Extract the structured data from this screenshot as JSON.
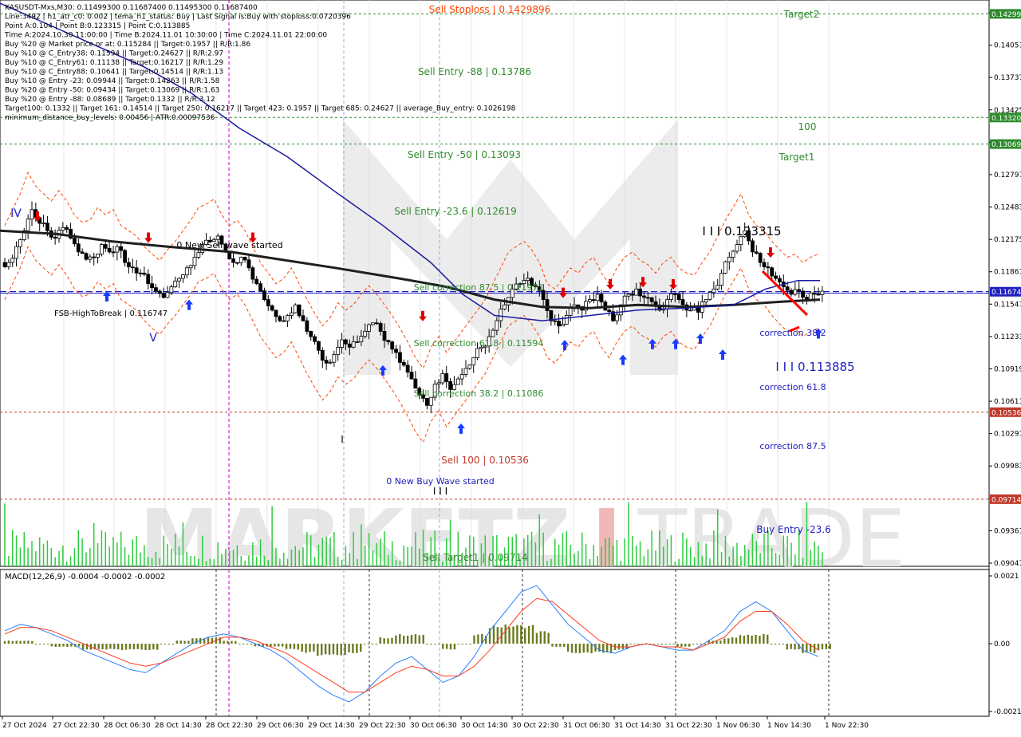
{
  "colors": {
    "background": "#ffffff",
    "grid": "#c8c8c8",
    "watermark": "#e6e6e6",
    "watermark_red": "#f2b7b7",
    "candle": "#000000",
    "volume": "#2ecc40",
    "ma_slow": "#1f1f1f",
    "ma_fast": "#1a1aa0",
    "envelope": "#ff4500",
    "level_green": "#2e8b2e",
    "level_red": "#c0392b",
    "level_blue": "#2020c0",
    "macd_hist": "#6b7a1f",
    "macd_main": "#2a7fff",
    "macd_signal": "#ff3b1f",
    "axis_text": "#000000"
  },
  "info_panel": [
    "KASUSDT-Mxs,M30: 0.11499300 0.11687400 0.11495300 0.11687400",
    "Line:3492 | h1_atr_c0: 0.002 | tema_h1_status: Buy | Last Signal is:Buy with stoploss:0.0720396",
    "Point A:0.104 | Point B:0.123315 | Point C:0.113885",
    "Time A:2024.10.30 11:00:00 | Time B:2024.11.01 10:30:00 | Time C:2024.11.01 22:00:00",
    "Buy %20 @ Market price or at: 0.115284 || Target:0.1957 || R/R:1.86",
    "Buy %10 @ C_Entry38: 0.11594 || Target:0.24627 || R/R:2.97",
    "Buy %10 @ C_Entry61: 0.11138 || Target:0.16217 || R/R:1.29",
    "Buy %10 @ C_Entry88: 0.10641 || Target:0.14514 || R/R:1.13",
    "Buy %10 @ Entry -23: 0.09944 || Target:0.14263 || R/R:1.58",
    "Buy %20 @ Entry -50: 0.09434 || Target:0.13069 || R/R:1.63",
    "Buy %20 @ Entry -88: 0.08689 || Target:0.1332 || R/R:3.12",
    "Target100: 0.1332 || Target 161: 0.14514 || Target 250: 0.16217 || Target 423: 0.1957 || Target 685: 0.24627 || average_Buy_entry: 0.1026198",
    "minimum_distance_buy_levels: 0.00456 | ATR:0.00097536"
  ],
  "chart_labels": {
    "sell_stoploss": "Sell Stoploss | 0.1429896",
    "target2": "Target2",
    "sell_entry_88": "Sell Entry -88 | 0.13786",
    "level_100": "100",
    "sell_entry_50": "Sell Entry -50 | 0.13093",
    "target1": "Target1",
    "sell_entry_23": "Sell Entry -23.6 | 0.12619",
    "peak_label": "I I I 0.123315",
    "new_sell_wave": "0 New Sell wave started",
    "sell_corr_875": "Sell correction 87.5 | 0.11971",
    "fsb": "FSB-HighToBreak | 0.116747",
    "sell_corr_618": "Sell correction 61.8 | 0.11594",
    "sell_corr_382": "Sell correction 38.2 | 0.11086",
    "correction_382": "correction 38.2",
    "c_label": "I I I 0.113885",
    "correction_618": "correction 61.8",
    "correction_875": "correction 87.5",
    "sell_100": "Sell 100 | 0.10536",
    "new_buy_wave": "0 New Buy Wave started",
    "buy_entry_23": "Buy Entry -23.6",
    "sell_target1": "Sell Target1 | 0.09714",
    "wave_iv": "IV",
    "wave_v": "V",
    "wave_i": "I",
    "wave_iii": "I I I"
  },
  "watermark": {
    "left": "MARKETZ",
    "bar": "I",
    "right": "TRADE"
  },
  "price_axis": {
    "ticks": [
      "0.14365",
      "0.14051",
      "0.13737",
      "0.13425",
      "0.13111",
      "0.12797",
      "0.12483",
      "0.12175",
      "0.11861",
      "0.11547",
      "0.11233",
      "0.10919",
      "0.10611",
      "0.10297",
      "0.09983",
      "0.09675",
      "0.09361",
      "0.09047"
    ],
    "current": "0.11674",
    "badges": [
      {
        "text": "0.14299",
        "color": "#2e8b2e"
      },
      {
        "text": "0.13320",
        "color": "#2e8b2e"
      },
      {
        "text": "0.13069",
        "color": "#2e8b2e"
      },
      {
        "text": "0.11674",
        "color": "#2020c0"
      },
      {
        "text": "0.10536",
        "color": "#c0392b"
      },
      {
        "text": "0.09714",
        "color": "#c0392b"
      }
    ]
  },
  "time_axis": [
    "27 Oct 2024",
    "27 Oct 22:30",
    "28 Oct 06:30",
    "28 Oct 14:30",
    "28 Oct 22:30",
    "29 Oct 06:30",
    "29 Oct 14:30",
    "29 Oct 22:30",
    "30 Oct 06:30",
    "30 Oct 14:30",
    "30 Oct 22:30",
    "31 Oct 06:30",
    "31 Oct 14:30",
    "31 Oct 22:30",
    "1 Nov 06:30",
    "1 Nov 14:30",
    "1 Nov 22:30"
  ],
  "macd": {
    "label": "MACD(12,26,9) -0.0004 -0.0002 -0.0002",
    "ticks": [
      "0.0021",
      "0.00",
      "-0.0021"
    ]
  },
  "chart_data": [
    {
      "type": "candlestick",
      "title": "KASUSDT-Mxs,M30",
      "ylim": [
        0.0908,
        0.1443
      ],
      "x_ticks": [
        "27 Oct 2024",
        "27 Oct 22:30",
        "28 Oct 06:30",
        "28 Oct 14:30",
        "28 Oct 22:30",
        "29 Oct 06:30",
        "29 Oct 14:30",
        "29 Oct 22:30",
        "30 Oct 06:30",
        "30 Oct 14:30",
        "30 Oct 22:30",
        "31 Oct 06:30",
        "31 Oct 14:30",
        "31 Oct 22:30",
        "1 Nov 06:30",
        "1 Nov 14:30",
        "1 Nov 22:30"
      ],
      "close_path": [
        0.1195,
        0.121,
        0.1225,
        0.1245,
        0.1232,
        0.1225,
        0.1218,
        0.1228,
        0.1218,
        0.1205,
        0.1198,
        0.12,
        0.1212,
        0.1205,
        0.121,
        0.1195,
        0.119,
        0.1185,
        0.1175,
        0.1168,
        0.1162,
        0.1172,
        0.118,
        0.119,
        0.12,
        0.1212,
        0.1215,
        0.122,
        0.1205,
        0.1195,
        0.12,
        0.119,
        0.1175,
        0.116,
        0.115,
        0.114,
        0.1145,
        0.1155,
        0.114,
        0.1125,
        0.1112,
        0.11,
        0.1108,
        0.1122,
        0.1115,
        0.112,
        0.113,
        0.1138,
        0.113,
        0.112,
        0.111,
        0.1098,
        0.1085,
        0.107,
        0.106,
        0.108,
        0.109,
        0.1075,
        0.1085,
        0.1095,
        0.1105,
        0.1115,
        0.1125,
        0.114,
        0.1155,
        0.117,
        0.1175,
        0.118,
        0.1172,
        0.116,
        0.114,
        0.1135,
        0.1145,
        0.1155,
        0.115,
        0.116,
        0.1165,
        0.115,
        0.114,
        0.1155,
        0.1165,
        0.117,
        0.1162,
        0.1158,
        0.115,
        0.116,
        0.1165,
        0.1155,
        0.115,
        0.1148,
        0.116,
        0.117,
        0.1185,
        0.12,
        0.1212,
        0.1225,
        0.1205,
        0.1195,
        0.119,
        0.118,
        0.1172,
        0.1165,
        0.1168,
        0.116,
        0.1165,
        0.1168
      ],
      "ma_slow": [
        [
          0,
          0.1225
        ],
        [
          70,
          0.1222
        ],
        [
          140,
          0.1215
        ],
        [
          210,
          0.121
        ],
        [
          290,
          0.1205
        ],
        [
          350,
          0.1198
        ],
        [
          420,
          0.119
        ],
        [
          500,
          0.118
        ],
        [
          560,
          0.1172
        ],
        [
          620,
          0.116
        ],
        [
          680,
          0.1153
        ],
        [
          740,
          0.1152
        ],
        [
          800,
          0.1155
        ],
        [
          860,
          0.1153
        ],
        [
          920,
          0.1155
        ],
        [
          980,
          0.1158
        ],
        [
          1028,
          0.116
        ]
      ],
      "ma_fast": [
        [
          0,
          0.144
        ],
        [
          60,
          0.142
        ],
        [
          120,
          0.14
        ],
        [
          180,
          0.138
        ],
        [
          240,
          0.1355
        ],
        [
          300,
          0.1322
        ],
        [
          360,
          0.1295
        ],
        [
          420,
          0.1262
        ],
        [
          480,
          0.123
        ],
        [
          540,
          0.1195
        ],
        [
          580,
          0.1165
        ],
        [
          620,
          0.1145
        ],
        [
          680,
          0.114
        ],
        [
          740,
          0.1145
        ],
        [
          800,
          0.115
        ],
        [
          860,
          0.1152
        ],
        [
          920,
          0.1155
        ],
        [
          960,
          0.117
        ],
        [
          1000,
          0.1178
        ],
        [
          1028,
          0.1178
        ]
      ],
      "levels": [
        {
          "name": "Sell Stoploss",
          "value": 0.14299,
          "color": "#2e8b2e"
        },
        {
          "name": "100",
          "value": 0.1332,
          "color": "#2e8b2e"
        },
        {
          "name": "Target1",
          "value": 0.13069,
          "color": "#2e8b2e"
        },
        {
          "name": "FSB-HighToBreak",
          "value": 0.116747,
          "color": "#2020c0"
        },
        {
          "name": "Sell 100",
          "value": 0.10536,
          "color": "#c0392b"
        },
        {
          "name": "Sell Target1",
          "value": 0.09714,
          "color": "#c0392b"
        }
      ],
      "buy_arrows": [
        [
          134,
          0.118
        ],
        [
          237,
          0.1172
        ],
        [
          480,
          0.111
        ],
        [
          578,
          0.1055
        ],
        [
          708,
          0.1134
        ],
        [
          781,
          0.112
        ],
        [
          818,
          0.1135
        ],
        [
          847,
          0.1135
        ],
        [
          878,
          0.114
        ],
        [
          906,
          0.1125
        ],
        [
          1026,
          0.1145
        ]
      ],
      "sell_arrows": [
        [
          47,
          0.1232
        ],
        [
          186,
          0.1212
        ],
        [
          317,
          0.1212
        ],
        [
          530,
          0.1138
        ],
        [
          706,
          0.116
        ],
        [
          765,
          0.1168
        ],
        [
          806,
          0.117
        ],
        [
          844,
          0.1168
        ],
        [
          966,
          0.1198
        ]
      ]
    },
    {
      "type": "bar",
      "title": "MACD(12,26,9)",
      "ylim": [
        -0.0021,
        0.0021
      ],
      "series": [
        {
          "name": "MACD",
          "values": [
            0.0004,
            0.0006,
            0.0005,
            0.0003,
            0.0001,
            -0.0002,
            -0.0004,
            -0.0006,
            -0.0008,
            -0.0009,
            -0.0006,
            -0.0003,
            0.0,
            0.0002,
            0.0003,
            0.0002,
            0.0,
            -0.0002,
            -0.0005,
            -0.0009,
            -0.0013,
            -0.0016,
            -0.0018,
            -0.0015,
            -0.001,
            -0.0006,
            -0.0004,
            -0.0008,
            -0.0012,
            -0.001,
            -0.0004,
            0.0004,
            0.001,
            0.0016,
            0.0018,
            0.0012,
            0.0006,
            0.0002,
            -0.0002,
            -0.0003,
            -0.0001,
            0.0,
            -0.0001,
            -0.0002,
            -0.0002,
            0.0001,
            0.0004,
            0.001,
            0.0013,
            0.001,
            0.0004,
            -0.0002,
            -0.0004
          ]
        },
        {
          "name": "Signal",
          "values": [
            0.0003,
            0.0005,
            0.0005,
            0.0004,
            0.0002,
            0.0,
            -0.0002,
            -0.0004,
            -0.0006,
            -0.0007,
            -0.0006,
            -0.0004,
            -0.0002,
            0.0,
            0.0002,
            0.0002,
            0.0001,
            -0.0001,
            -0.0003,
            -0.0006,
            -0.0009,
            -0.0012,
            -0.0015,
            -0.0015,
            -0.0012,
            -0.0009,
            -0.0007,
            -0.0008,
            -0.001,
            -0.001,
            -0.0007,
            -0.0002,
            0.0004,
            0.001,
            0.0014,
            0.0013,
            0.0009,
            0.0005,
            0.0001,
            -0.0001,
            -0.0001,
            0.0,
            -0.0001,
            -0.0001,
            -0.0002,
            0.0,
            0.0002,
            0.0007,
            0.001,
            0.001,
            0.0006,
            0.0001,
            -0.0002
          ]
        },
        {
          "name": "Histogram",
          "values": [
            0.0001,
            0.0001,
            0.0,
            -0.0001,
            -0.0001,
            -0.0002,
            -0.0002,
            -0.0002,
            -0.0002,
            -0.0002,
            0.0,
            0.0001,
            0.0002,
            0.0002,
            0.0001,
            0.0,
            -0.0001,
            -0.0001,
            -0.0002,
            -0.0003,
            -0.0004,
            -0.0004,
            -0.0003,
            0.0,
            0.0002,
            0.0003,
            0.0003,
            0.0,
            -0.0002,
            0.0,
            0.0003,
            0.0006,
            0.0006,
            0.0006,
            0.0004,
            -0.0001,
            -0.0003,
            -0.0003,
            -0.0003,
            -0.0002,
            0.0,
            0.0,
            0.0,
            -0.0001,
            0.0,
            0.0001,
            0.0002,
            0.0003,
            0.0003,
            0.0,
            -0.0002,
            -0.0003,
            -0.0002
          ]
        }
      ]
    }
  ]
}
